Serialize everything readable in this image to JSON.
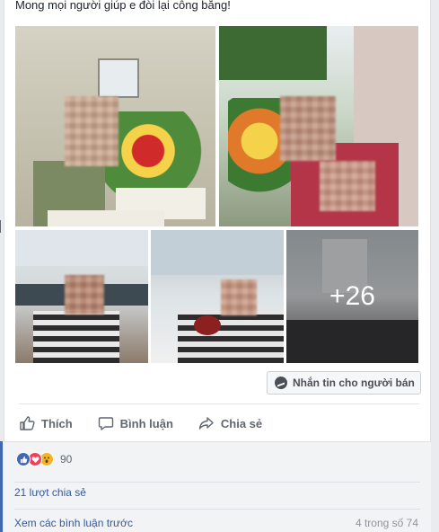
{
  "post": {
    "caption": "Mong mọi người giúp e đòi lại công bằng!",
    "more_photos": "+26"
  },
  "seller": {
    "message_button": "Nhắn tin cho người bán",
    "message_icon": "messenger-icon"
  },
  "actions": {
    "like": "Thích",
    "comment": "Bình luận",
    "share": "Chia sẻ"
  },
  "reactions": {
    "icons": [
      "like-icon",
      "love-icon",
      "wow-icon"
    ],
    "colors": {
      "like": "#4267b2",
      "love": "#f33e58",
      "wow": "#f7b125"
    },
    "count": "90"
  },
  "shares": {
    "label": "21 lượt chia sẻ"
  },
  "comments": {
    "view_previous": "Xem các bình luận trước",
    "pager": "4 trong số 74"
  }
}
